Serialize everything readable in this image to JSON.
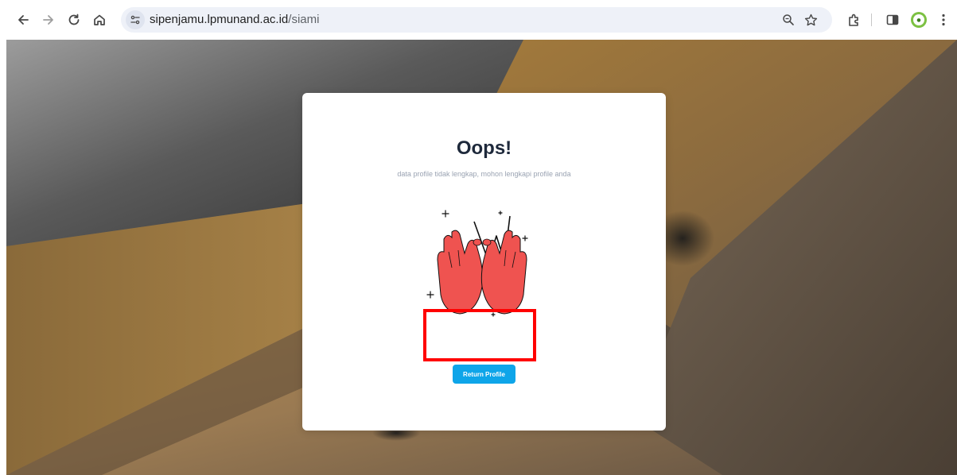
{
  "browser": {
    "url_host": "sipenjamu.lpmunand.ac.id",
    "url_path": "/siami",
    "icons": [
      "back-arrow-icon",
      "forward-arrow-icon",
      "reload-icon",
      "home-icon",
      "site-info-icon",
      "zoom-icon",
      "bookmark-star-icon",
      "extensions-icon",
      "side-panel-icon",
      "profile-avatar-icon",
      "menu-kebab-icon"
    ]
  },
  "page": {
    "title": "Oops!",
    "subtitle": "data profile tidak lengkap, mohon lengkapi profile anda",
    "button_label": "Return Profile",
    "illustration_icon": "hands-illustration-icon"
  },
  "colors": {
    "button": "#0ea5e9",
    "highlight": "#ff0000",
    "hands": "#ef5350",
    "title": "#1e293b"
  }
}
